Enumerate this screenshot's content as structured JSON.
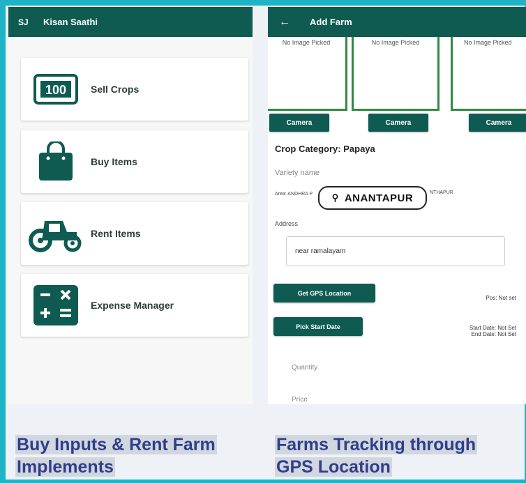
{
  "colors": {
    "frame": "#1db5c6",
    "appbar": "#0f5b51",
    "caption": "#2f3e8c",
    "image_border": "#2f8a3f"
  },
  "left_screen": {
    "header": {
      "leading": "SJ",
      "title": "Kisan Saathi"
    },
    "menu": [
      {
        "label": "Sell Crops",
        "icon": "scale-counter-icon"
      },
      {
        "label": "Buy Items",
        "icon": "shopping-bag-icon"
      },
      {
        "label": "Rent Items",
        "icon": "tractor-icon"
      },
      {
        "label": "Expense Manager",
        "icon": "calculator-icon"
      }
    ],
    "counter_text": "100"
  },
  "right_screen": {
    "header": {
      "back_icon": "back-arrow-icon",
      "back_glyph": "←",
      "title": "Add Farm"
    },
    "image_slots": [
      {
        "placeholder": "No Image Picked",
        "button": "Camera"
      },
      {
        "placeholder": "No Image Picked",
        "button": "Camera"
      },
      {
        "placeholder": "No Image Picked",
        "button": "Camera"
      }
    ],
    "crop_category": "Crop Category: Papaya",
    "variety_placeholder": "Variety name",
    "area_label": "Area: ANDHRA P",
    "area_label_right": "NTHAPUR",
    "location_chip": "ANANTAPUR",
    "location_pin": "⚲",
    "address_label": "Address",
    "address_value": "near ramalayam",
    "gps_button": "Get GPS Location",
    "position_text": "Pos: Not set",
    "start_date_button": "Pick Start Date",
    "start_date_text": "Start Date: Not Set",
    "end_date_text": "End Date: Not Set",
    "quantity_placeholder": "Quantity",
    "price_placeholder": "Price"
  },
  "captions": {
    "left_line1": "Buy Inputs & Rent Farm",
    "left_line2": "Implements",
    "right_line1": "Farms Tracking through",
    "right_line2": "GPS Location"
  }
}
